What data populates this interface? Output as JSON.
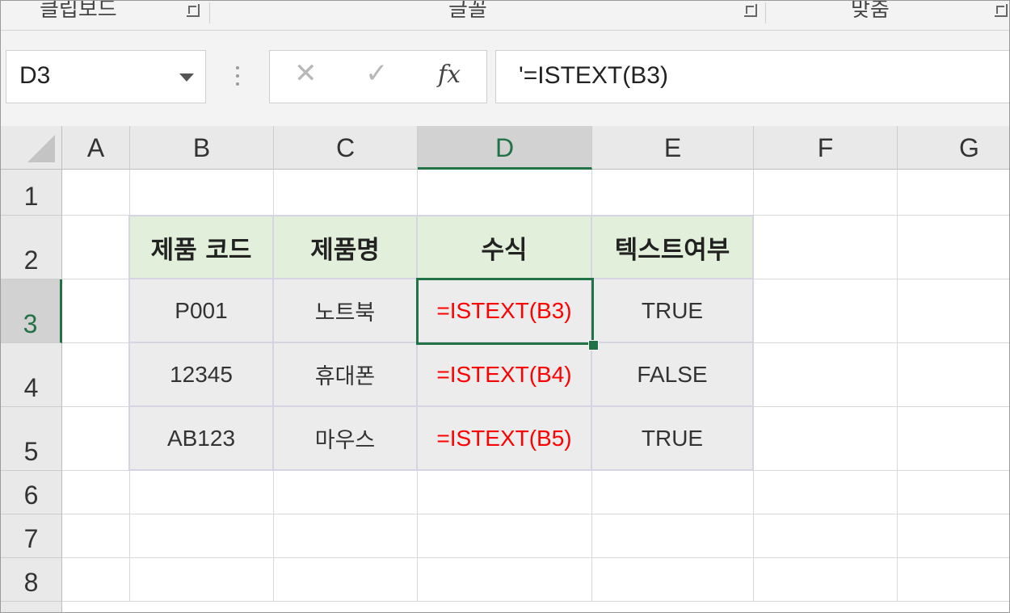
{
  "ribbon": {
    "groups": [
      {
        "label": "클립보드"
      },
      {
        "label": "글꼴"
      },
      {
        "label": "맞춤"
      }
    ]
  },
  "formula_bar": {
    "name_box": "D3",
    "cancel_icon": "close-icon",
    "enter_icon": "check-icon",
    "fx_label": "fx",
    "formula": "'=ISTEXT(B3)"
  },
  "sheet": {
    "columns": [
      "A",
      "B",
      "C",
      "D",
      "E",
      "F",
      "G"
    ],
    "selected_column": "D",
    "rows": [
      "1",
      "2",
      "3",
      "4",
      "5",
      "6",
      "7",
      "8"
    ],
    "selected_row": "3",
    "table_header": [
      "제품 코드",
      "제품명",
      "수식",
      "텍스트여부"
    ],
    "table_rows": [
      [
        "P001",
        "노트북",
        "=ISTEXT(B3)",
        "TRUE"
      ],
      [
        "12345",
        "휴대폰",
        "=ISTEXT(B4)",
        "FALSE"
      ],
      [
        "AB123",
        "마우스",
        "=ISTEXT(B5)",
        "TRUE"
      ]
    ]
  },
  "colors": {
    "accent": "#217346",
    "header_fill": "#e2efda",
    "data_fill": "#ececec",
    "formula_text": "#ff0000"
  }
}
